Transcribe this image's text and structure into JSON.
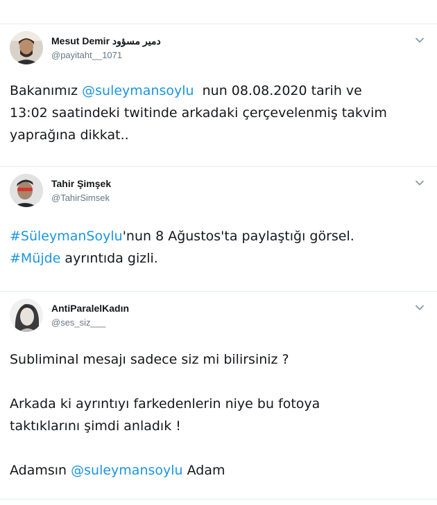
{
  "tweets": [
    {
      "name": "Mesut Demir دمير مسؤود",
      "handle": "@payitaht__1071",
      "text_1": "Bakanımız ",
      "mention": "@suleymansoylu",
      "text_2": "  nun 08.08.2020 tarih ve\n13:02 saatindeki twitinde arkadaki çerçevelenmiş takvim\nyaprağına dikkat.."
    },
    {
      "name": "Tahir Şimşek",
      "handle": "@TahirSimsek",
      "hashtag_1": "#SüleymanSoylu",
      "text_1": "'nun 8 Ağustos'ta paylaştığı görsel.\n",
      "hashtag_2": "#Müjde",
      "text_2": " ayrıntıda gizli."
    },
    {
      "name": "AntiParalelKadın",
      "handle": "@ses_siz___",
      "text_1": "Subliminal mesajı sadece siz mi bilirsiniz ?\n\nArkada ki ayrıntıyı farkedenlerin niye bu fotoya\ntaktıklarını şimdi anladık !\n\nAdamsın ",
      "mention": "@suleymansoylu",
      "text_2": " Adam"
    }
  ],
  "icons": {
    "menu": "chevron-down-icon",
    "avatar": "avatar"
  },
  "colors": {
    "link": "#1b95e0",
    "muted": "#657786",
    "divider": "#e6ecf0"
  }
}
